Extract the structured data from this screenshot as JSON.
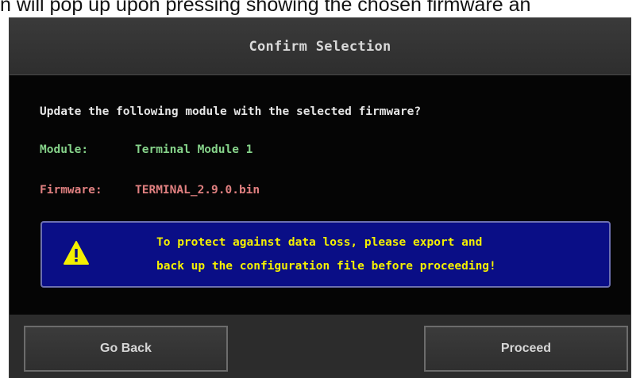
{
  "caption": {
    "text": "n will pop up upon pressing showing the chosen firmware an"
  },
  "dialog": {
    "title": "Confirm Selection",
    "question": "Update the following module with the selected firmware?",
    "module": {
      "label": "Module:",
      "value": "Terminal Module 1",
      "color": "#86d38a"
    },
    "firmware": {
      "label": "Firmware:",
      "value": "TERMINAL_2.9.0.bin",
      "color": "#e08080"
    },
    "warning": {
      "icon": "warning-triangle-icon",
      "line1": "To protect against data loss, please export and",
      "line2": "back up the configuration file before proceeding!",
      "background": "#0a0e86",
      "text_color": "#f4f000"
    },
    "buttons": {
      "back": "Go Back",
      "proceed": "Proceed"
    }
  }
}
